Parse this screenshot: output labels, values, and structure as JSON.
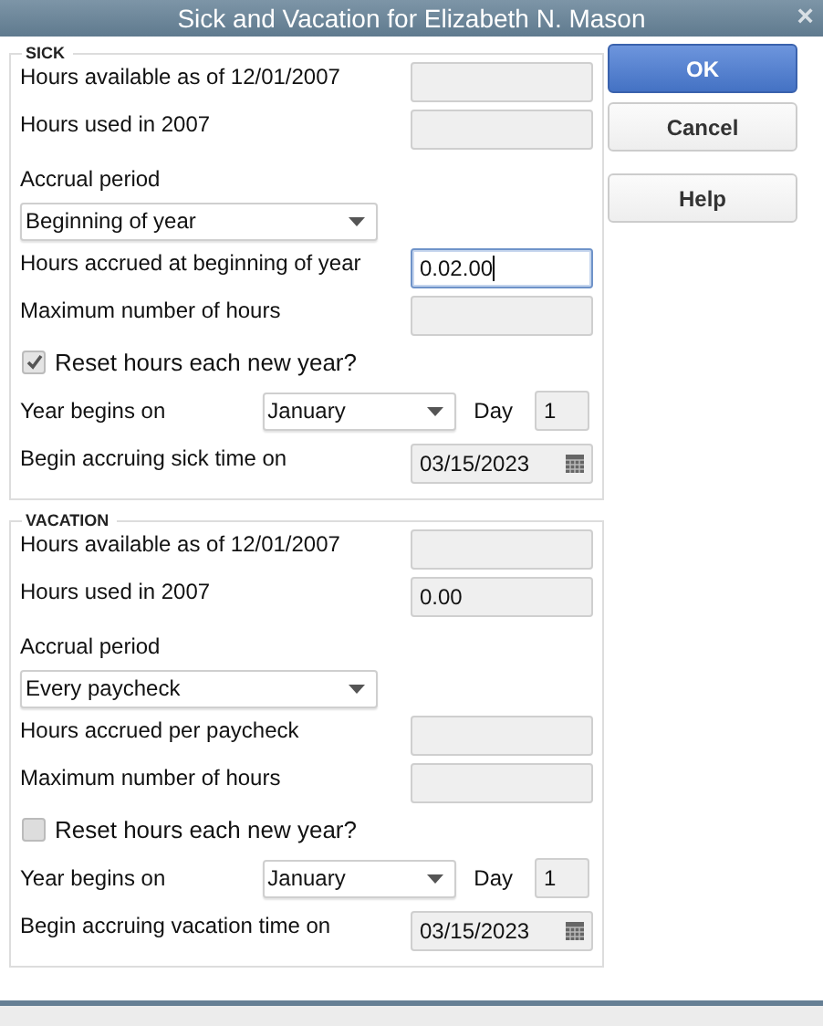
{
  "window": {
    "title": "Sick and Vacation for Elizabeth N. Mason",
    "close": "×"
  },
  "sections": [
    {
      "title": "SICK",
      "rows": [
        {
          "kind": "field",
          "label": "Hours available as of 12/01/2007",
          "value": "",
          "focused": false
        },
        {
          "kind": "field",
          "label": "Hours used in 2007",
          "value": "",
          "focused": false
        },
        {
          "kind": "heading",
          "label": "Accrual period"
        },
        {
          "kind": "dropdown",
          "value": "Beginning of year"
        },
        {
          "kind": "field",
          "label": "Hours accrued at beginning of year",
          "value": "0.02.00",
          "focused": true
        },
        {
          "kind": "field",
          "label": "Maximum number of hours",
          "value": "",
          "focused": false
        },
        {
          "kind": "checkbox",
          "label": "Reset hours each new year?",
          "checked": true
        },
        {
          "kind": "year",
          "label": "Year begins on",
          "value": "January",
          "day_label": "Day",
          "day": "1"
        },
        {
          "kind": "date",
          "label": "Begin accruing sick time on",
          "value": "03/15/2023"
        }
      ]
    },
    {
      "title": "VACATION",
      "rows": [
        {
          "kind": "field",
          "label": "Hours available as of 12/01/2007",
          "value": "",
          "focused": false
        },
        {
          "kind": "field",
          "label": "Hours used in 2007",
          "value": "0.00",
          "focused": false
        },
        {
          "kind": "heading",
          "label": "Accrual period"
        },
        {
          "kind": "dropdown",
          "value": "Every paycheck"
        },
        {
          "kind": "field",
          "label": "Hours accrued per paycheck",
          "value": "",
          "focused": false
        },
        {
          "kind": "field",
          "label": "Maximum number of hours",
          "value": "",
          "focused": false
        },
        {
          "kind": "checkbox",
          "label": "Reset hours each new year?",
          "checked": false
        },
        {
          "kind": "year",
          "label": "Year begins on",
          "value": "January",
          "day_label": "Day",
          "day": "1"
        },
        {
          "kind": "date",
          "label": "Begin accruing vacation time on",
          "value": "03/15/2023"
        }
      ]
    }
  ],
  "buttons": [
    {
      "label": "OK",
      "primary": true
    },
    {
      "label": "Cancel",
      "primary": false
    },
    {
      "label": "Help",
      "primary": false
    }
  ]
}
